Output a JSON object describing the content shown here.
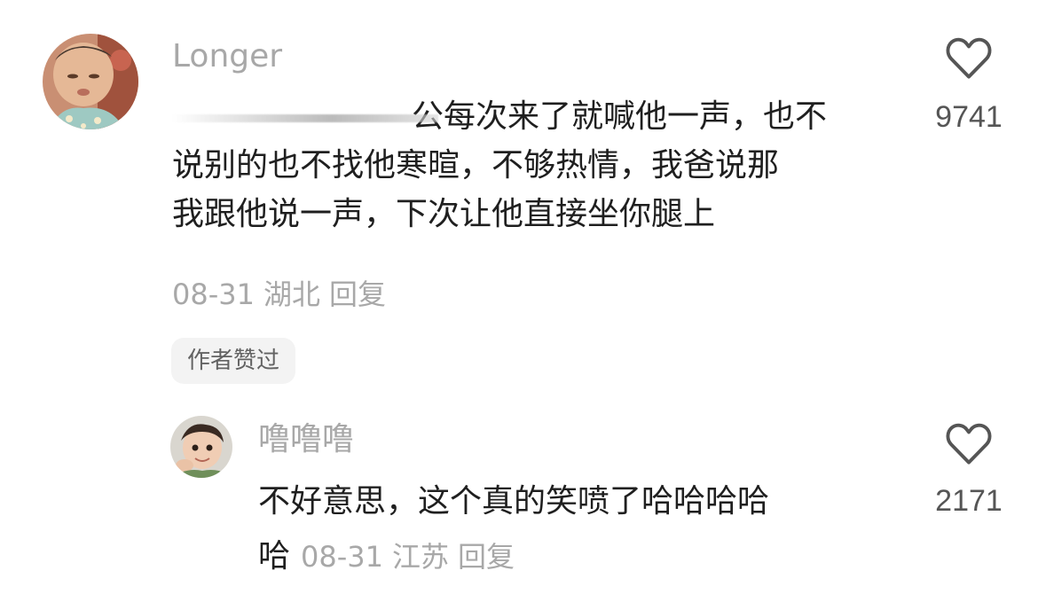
{
  "comment": {
    "username": "Longer",
    "text_lines": [
      "公每次来了就喊他一声，也不",
      "说别的也不找他寒暄，不够热情，我爸说那",
      "我跟他说一声，下次让他直接坐你腿上"
    ],
    "date": "08-31",
    "location": "湖北",
    "reply_label": "回复",
    "author_badge": "作者赞过",
    "like_count": "9741",
    "like_icon": "heart-outline-icon"
  },
  "reply": {
    "username": "噜噜噜",
    "text_lines": [
      "不好意思，这个真的笑喷了哈哈哈哈",
      "哈"
    ],
    "date": "08-31",
    "location": "江苏",
    "reply_label": "回复",
    "like_count": "2171",
    "like_icon": "heart-outline-icon"
  },
  "colors": {
    "username": "#a8a8a8",
    "text": "#1f1f1f",
    "meta": "#a8a8a8",
    "badge_bg": "#f3f3f3",
    "badge_text": "#636363",
    "like_count": "#555555"
  }
}
